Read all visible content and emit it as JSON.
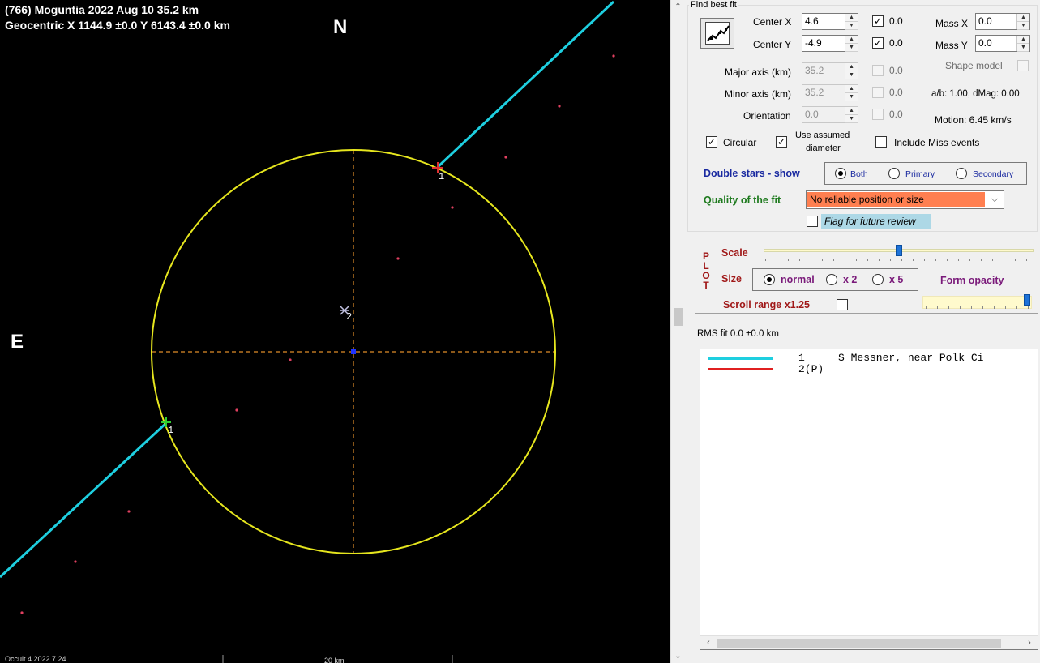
{
  "plot": {
    "title_line1": "(766) Moguntia  2022 Aug 10   35.2 km",
    "title_line2": "Geocentric  X  1144.9 ±0.0  Y 6143.4 ±0.0 km",
    "compass_n": "N",
    "compass_e": "E",
    "footer_version": "Occult 4.2022.7.24",
    "footer_scale": "20 km",
    "chord_labels": [
      "1",
      "1",
      "2"
    ],
    "colors": {
      "background": "#000000",
      "ellipse": "#e6e61e",
      "chord_visible": "#1ecfe0",
      "axis_lines": "#e08c28",
      "center_marker": "#1e32ff",
      "point_red": "#e03030",
      "point_green": "#30d030",
      "stray_points": "#e04060"
    }
  },
  "panel": {
    "find_best_fit": "Find best fit",
    "fit_button_icon": "chart-fit-icon",
    "center_x_label": "Center X",
    "center_x_value": "4.6",
    "center_x_check": "0.0",
    "center_y_label": "Center Y",
    "center_y_value": "-4.9",
    "center_y_check": "0.0",
    "mass_x_label": "Mass X",
    "mass_x_value": "0.0",
    "mass_y_label": "Mass Y",
    "mass_y_value": "0.0",
    "major_axis_label": "Major axis (km)",
    "major_axis_value": "35.2",
    "major_axis_check": "0.0",
    "minor_axis_label": "Minor axis (km)",
    "minor_axis_value": "35.2",
    "minor_axis_check": "0.0",
    "orientation_label": "Orientation",
    "orientation_value": "0.0",
    "orientation_check": "0.0",
    "shape_model_label": "Shape model",
    "ab_dmag": "a/b: 1.00, dMag: 0.00",
    "motion": "Motion: 6.45 km/s",
    "circular_label": "Circular",
    "use_assumed_label_1": "Use assumed",
    "use_assumed_label_2": "diameter",
    "include_miss_label": "Include Miss events",
    "double_stars_label": "Double stars - show",
    "radio_both": "Both",
    "radio_primary": "Primary",
    "radio_secondary": "Secondary",
    "quality_label": "Quality of the fit",
    "quality_value": "No reliable position or size",
    "flag_review_label": "Flag for future review",
    "plot_vertical": [
      "P",
      "L",
      "O",
      "T"
    ],
    "scale_label": "Scale",
    "size_label": "Size",
    "size_normal": "normal",
    "size_x2": "x 2",
    "size_x5": "x 5",
    "form_opacity_label": "Form opacity",
    "scroll_range_label": "Scroll range x1.25",
    "rms_fit": "RMS fit 0.0 ±0.0 km",
    "legend_rows": [
      {
        "num": "1",
        "text": "S Messner, near Polk Ci",
        "color": "#1ecfe0"
      },
      {
        "num": "2(P)",
        "text": "",
        "color": "#e02020"
      }
    ],
    "scale_level": 0.5,
    "opacity_level": 1.0
  }
}
